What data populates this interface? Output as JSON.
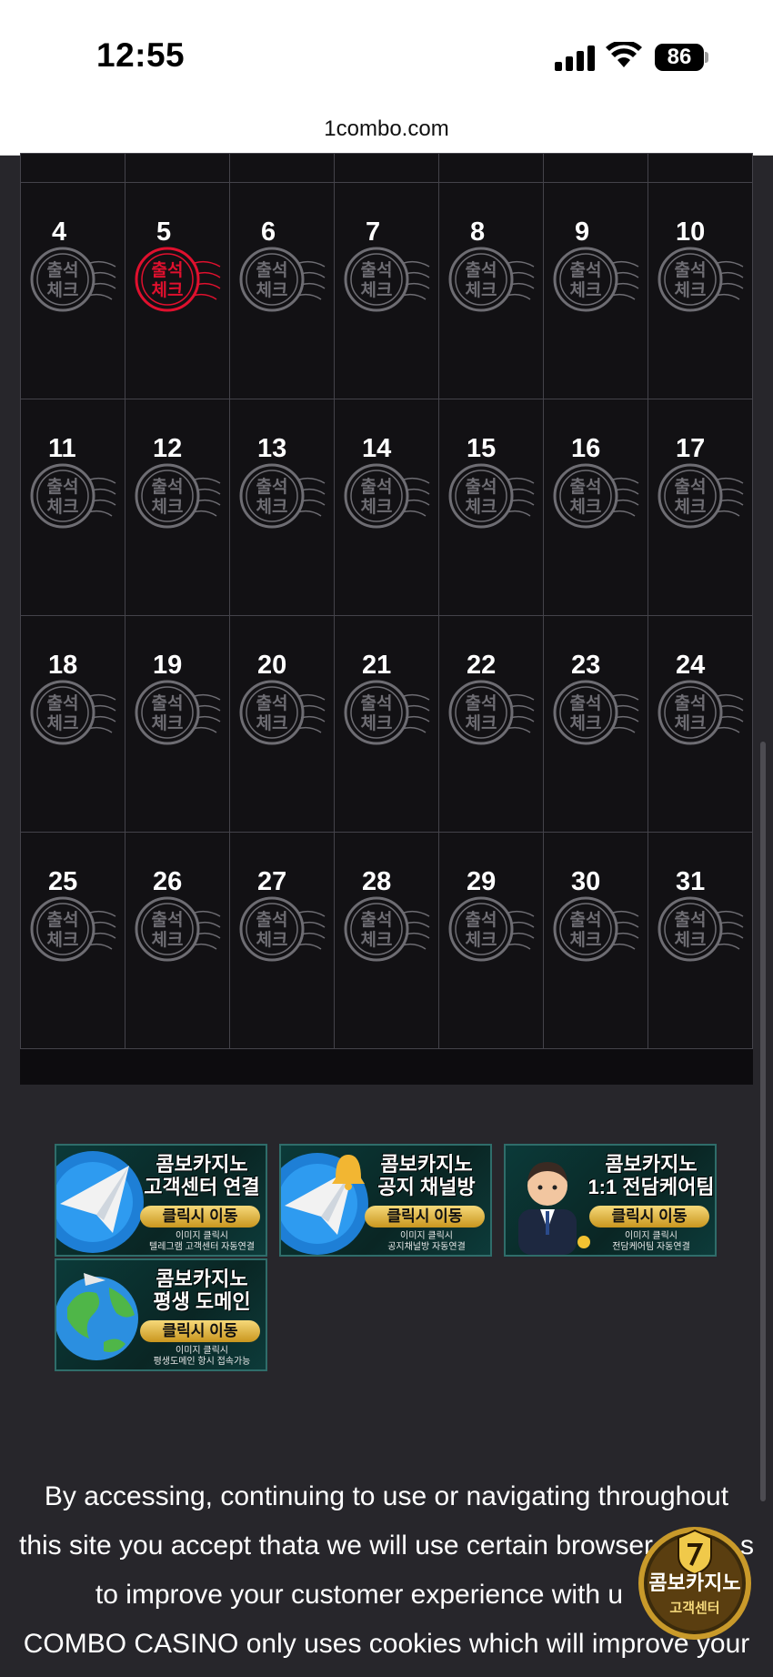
{
  "status_bar": {
    "time": "12:55",
    "battery": "86"
  },
  "browser": {
    "url": "1combo.com"
  },
  "calendar": {
    "stamp_text_line1": "출석",
    "stamp_text_line2": "체크",
    "checked_day": "5",
    "weeks": [
      [
        "4",
        "5",
        "6",
        "7",
        "8",
        "9",
        "10"
      ],
      [
        "11",
        "12",
        "13",
        "14",
        "15",
        "16",
        "17"
      ],
      [
        "18",
        "19",
        "20",
        "21",
        "22",
        "23",
        "24"
      ],
      [
        "25",
        "26",
        "27",
        "28",
        "29",
        "30",
        "31"
      ]
    ]
  },
  "banners": [
    {
      "title_line1": "콤보카지노",
      "title_line2": "고객센터 연결",
      "button": "클릭시 이동",
      "small_line1": "이미지 클릭시",
      "small_line2": "텔레그램 고객센터 자동연결",
      "icon": "telegram-plane-icon"
    },
    {
      "title_line1": "콤보카지노",
      "title_line2": "공지 채널방",
      "button": "클릭시 이동",
      "small_line1": "이미지 클릭시",
      "small_line2": "공지채널방 자동연결",
      "icon": "telegram-bell-icon"
    },
    {
      "title_line1": "콤보카지노",
      "title_line2": "1:1 전담케어팀",
      "button": "클릭시 이동",
      "small_line1": "이미지 클릭시",
      "small_line2": "전담케어팀 자동연결",
      "icon": "agent-avatar-icon"
    },
    {
      "title_line1": "콤보카지노",
      "title_line2": "평생 도메인",
      "button": "클릭시 이동",
      "small_line1": "이미지 클릭시",
      "small_line2": "평생도메인 항시 접속가능",
      "icon": "globe-icon"
    }
  ],
  "terms": {
    "line1": "By accessing, continuing to use or navigating throughout",
    "line2": "this site you accept thata we will use certain browser",
    "line2_tail": "s",
    "line3": "to improve your customer experience with u",
    "line4": "COMBO CASINO only uses cookies which will improve your"
  },
  "support_badge": {
    "title": "콤보카지노",
    "subtitle": "고객센터"
  },
  "colors": {
    "stamp_gray": "#6e6d73",
    "stamp_red": "#e0102e",
    "banner_border": "#2f6d6a",
    "button_gold": "#d9aa3a"
  }
}
